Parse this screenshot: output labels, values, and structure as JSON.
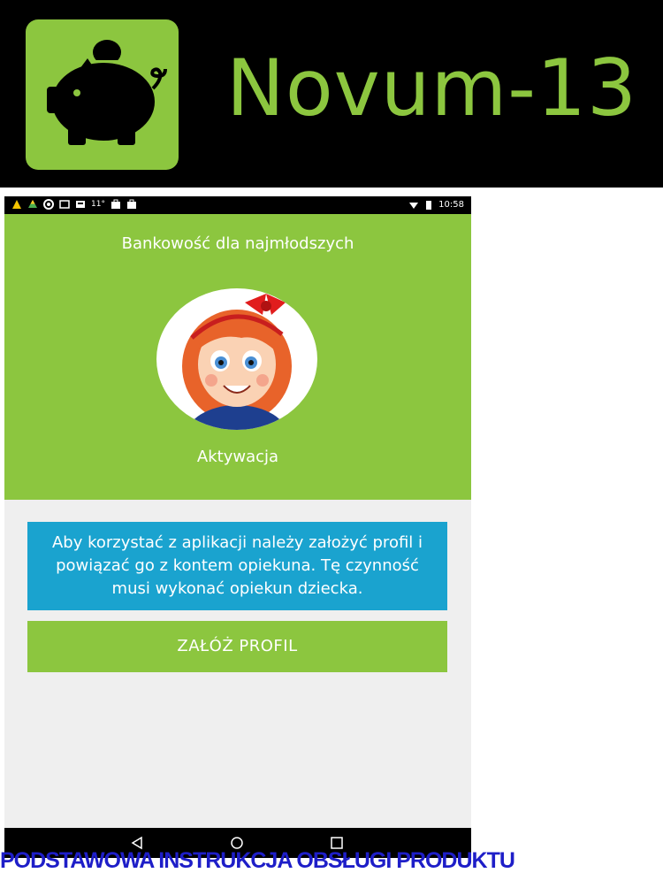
{
  "banner": {
    "brand_name": "Novum-13",
    "overlap_text": "",
    "colors": {
      "brand_green": "#8cc63f",
      "background": "#000000"
    },
    "logo_icon": "piggy-bank-icon"
  },
  "statusbar": {
    "time": "10:58",
    "icons_left": [
      "warning-icon",
      "drive-icon",
      "chrome-icon",
      "screenshot-icon",
      "gallery-icon",
      "temperature-icon",
      "bag-icon",
      "bag-icon"
    ],
    "temperature": "11°",
    "icons_right": [
      "wifi-icon",
      "battery-icon"
    ]
  },
  "screen": {
    "subtitle": "Bankowość dla najmłodszych",
    "avatar_icon": "girl-avatar-icon",
    "activation_label": "Aktywacja",
    "info_text": "Aby korzystać z aplikacji należy założyć profil i powiązać go z kontem opiekuna. Tę czynność musi wykonać opiekun dziecka.",
    "create_profile_button": "ZAŁÓŻ PROFIL",
    "colors": {
      "green": "#8cc63f",
      "blue": "#1aa3cf",
      "panel": "#efefef"
    }
  },
  "navbar": {
    "back": "◁",
    "home": "○",
    "recent": "□"
  },
  "footer": {
    "title": "PODSTAWOWA INSTRUKCJA OBSŁUGI PRODUKTU",
    "title_color": "#1e1ec8"
  }
}
